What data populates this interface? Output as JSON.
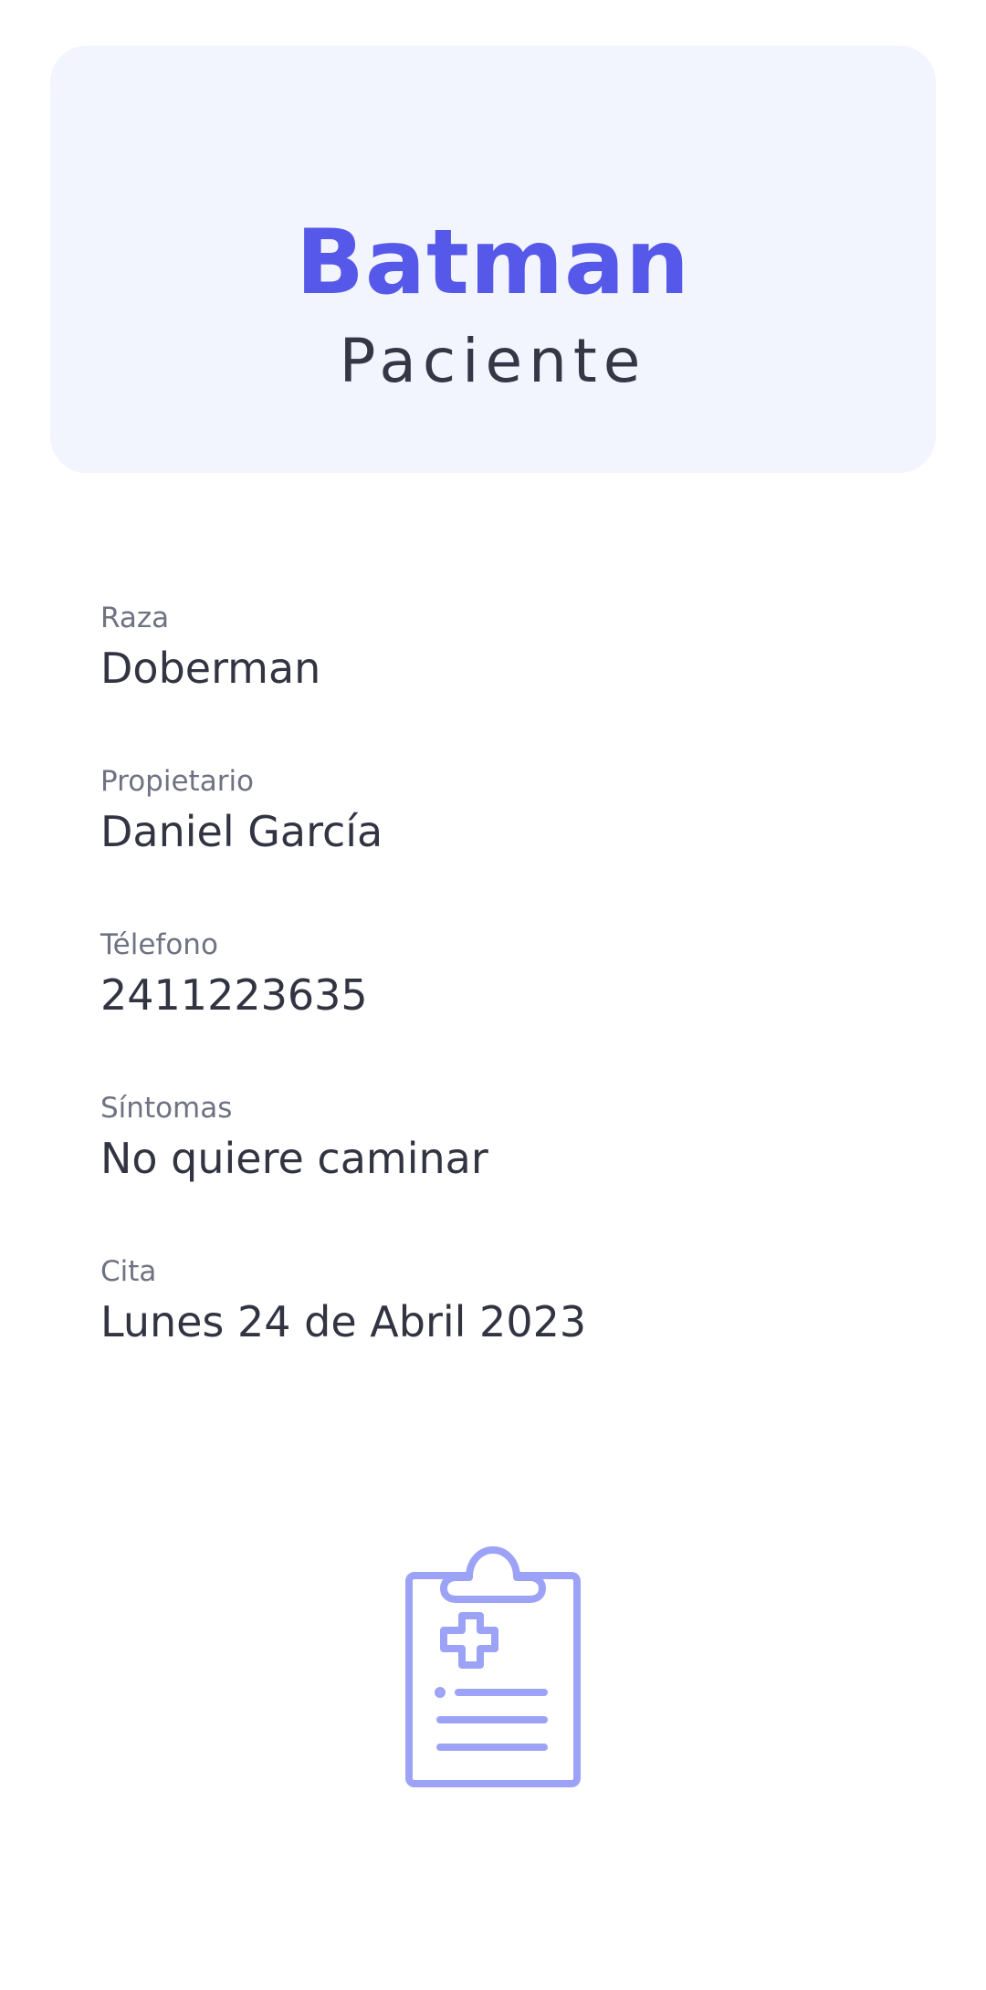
{
  "header": {
    "name": "Batman",
    "role": "Paciente"
  },
  "details": [
    {
      "label": "Raza",
      "value": "Doberman"
    },
    {
      "label": "Propietario",
      "value": "Daniel García"
    },
    {
      "label": "Télefono",
      "value": "2411223635"
    },
    {
      "label": "Síntomas",
      "value": "No quiere caminar"
    },
    {
      "label": "Cita",
      "value": "Lunes 24 de Abril 2023"
    }
  ],
  "icon": {
    "name": "medical-clipboard-icon",
    "color": "#9ca3f7"
  },
  "colors": {
    "accent": "#5558e8",
    "card_background": "#f2f4fe",
    "text_primary": "#323442",
    "text_secondary": "#6f7282"
  }
}
